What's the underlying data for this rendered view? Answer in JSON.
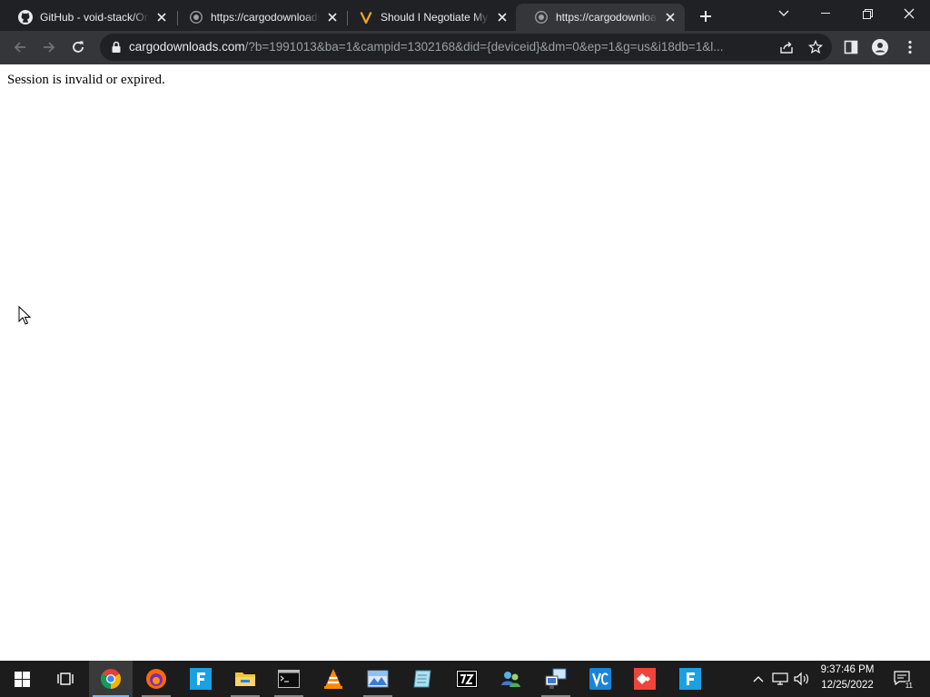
{
  "browser": {
    "tabs": [
      {
        "title": "GitHub - void-stack/Omni",
        "favicon": "github-icon",
        "active": false
      },
      {
        "title": "https://cargodownloads.com",
        "favicon": "globe-icon",
        "active": false
      },
      {
        "title": "Should I Negotiate My Salary",
        "favicon": "v-logo-icon",
        "active": false
      },
      {
        "title": "https://cargodownloads.com",
        "favicon": "globe-icon",
        "active": true
      }
    ],
    "address_bar": {
      "host": "cargodownloads.com",
      "path": "/?b=1991013&ba=1&campid=1302168&did={deviceid}&dm=0&ep=1&g=us&i18db=1&l..."
    }
  },
  "page": {
    "message": "Session is invalid or expired."
  },
  "taskbar": {
    "apps": [
      "start-icon",
      "task-view-icon",
      "chrome-icon",
      "firefox-icon",
      "f-app-icon",
      "file-explorer-icon",
      "terminal-icon",
      "vlc-icon",
      "image-viewer-icon",
      "notepad-icon",
      "7zip-icon",
      "network-users-icon",
      "remote-desktop-icon",
      "vscode-icon",
      "anydesk-icon",
      "f-app-icon"
    ],
    "clock": {
      "time": "9:37:46 PM",
      "date": "12/25/2022"
    },
    "notification_count": "11"
  },
  "colors": {
    "tab_strip": "#202124",
    "toolbar": "#35363a",
    "taskbar": "#1c1c1c",
    "accent": "#76b9ed"
  }
}
